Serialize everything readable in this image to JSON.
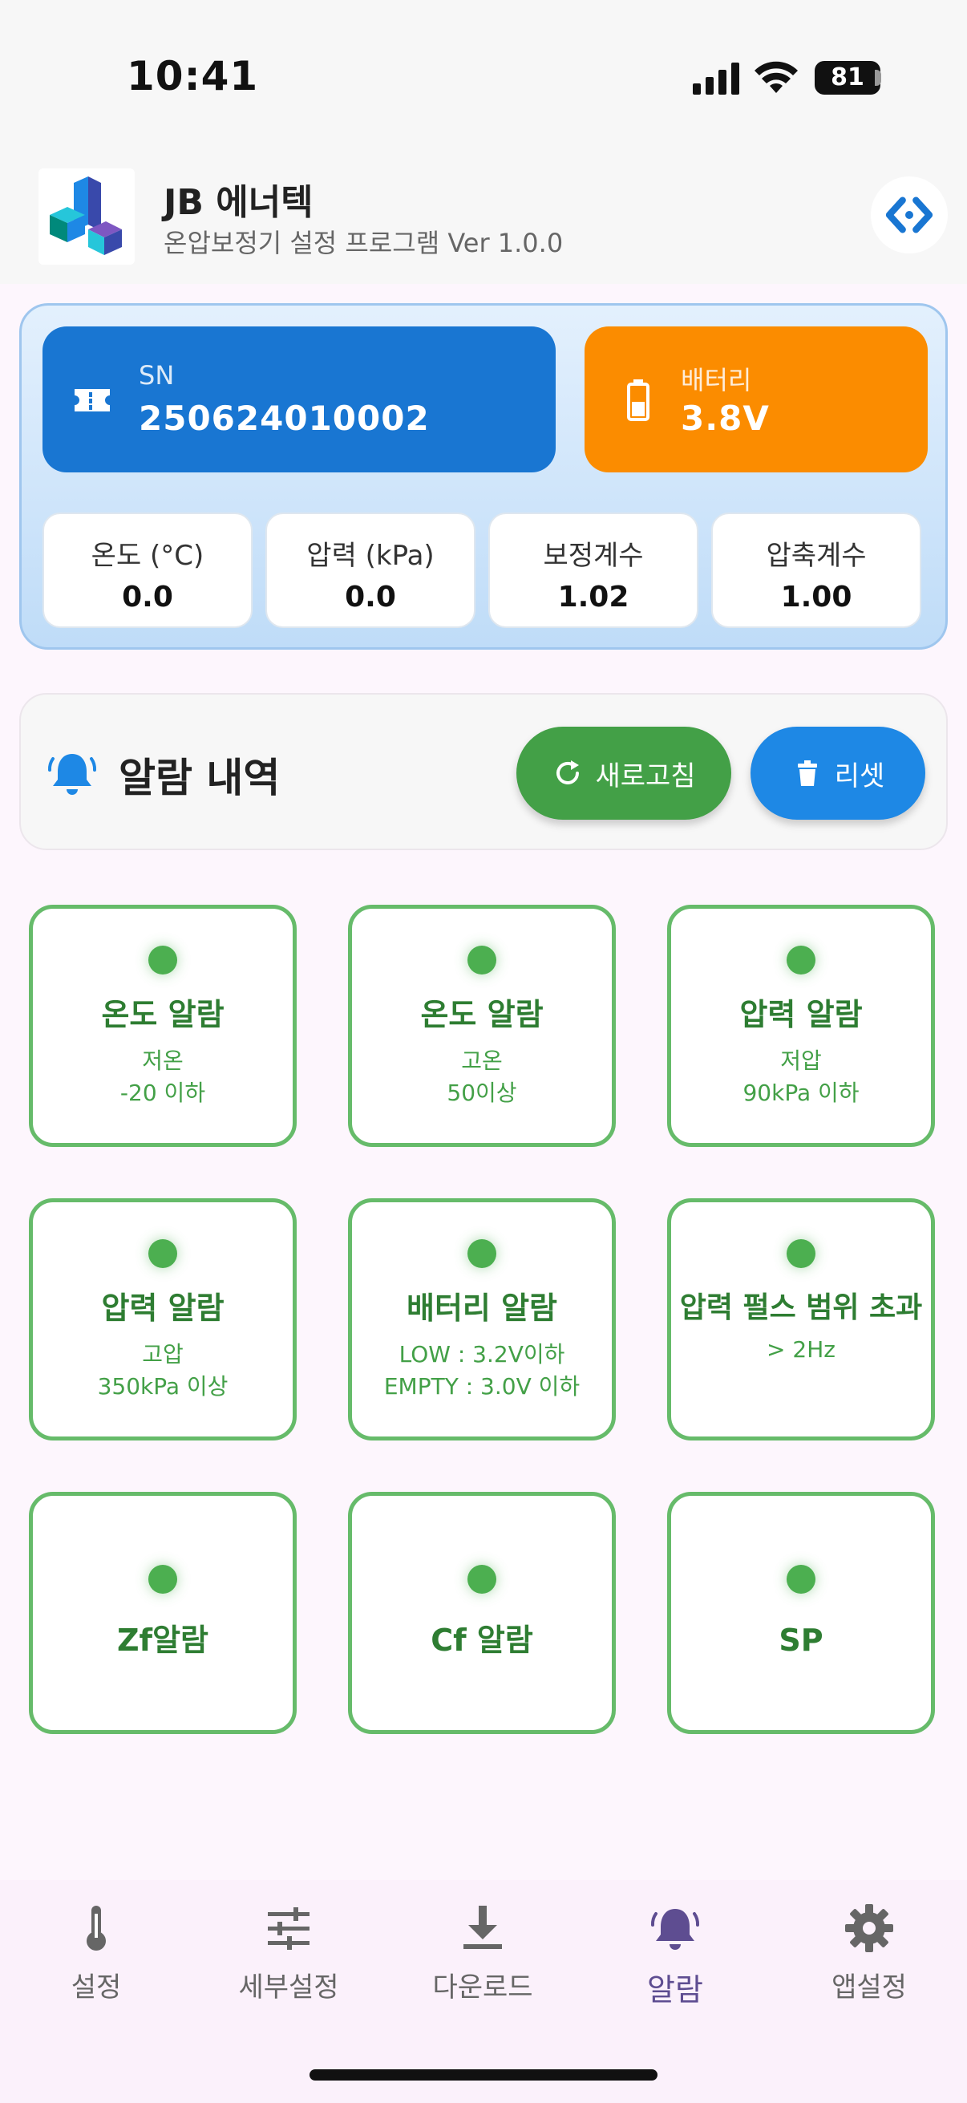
{
  "status_bar": {
    "time": "10:41",
    "battery": "81"
  },
  "header": {
    "title": "JB 에너텍",
    "subtitle": "온압보정기 설정 프로그램 Ver 1.0.0"
  },
  "device": {
    "sn_label": "SN",
    "sn_value": "250624010002",
    "battery_label": "배터리",
    "battery_value": "3.8V",
    "metrics": [
      {
        "label": "온도 (°C)",
        "value": "0.0"
      },
      {
        "label": "압력 (kPa)",
        "value": "0.0"
      },
      {
        "label": "보정계수",
        "value": "1.02"
      },
      {
        "label": "압축계수",
        "value": "1.00"
      }
    ]
  },
  "alarm_section": {
    "title": "알람 내역",
    "refresh_label": "새로고침",
    "reset_label": "리셋"
  },
  "alarms": [
    {
      "name": "온도 알람",
      "desc1": "저온",
      "desc2": "-20 이하"
    },
    {
      "name": "온도 알람",
      "desc1": "고온",
      "desc2": "50이상"
    },
    {
      "name": "압력 알람",
      "desc1": "저압",
      "desc2": "90kPa 이하"
    },
    {
      "name": "압력 알람",
      "desc1": "고압",
      "desc2": "350kPa 이상"
    },
    {
      "name": "배터리 알람",
      "desc1": "LOW : 3.2V이하",
      "desc2": "EMPTY : 3.0V 이하"
    },
    {
      "name": "압력 펄스 범위 초과",
      "desc1": "> 2Hz",
      "desc2": ""
    },
    {
      "name": "Zf알람",
      "desc1": "",
      "desc2": ""
    },
    {
      "name": "Cf 알람",
      "desc1": "",
      "desc2": ""
    },
    {
      "name": "SP",
      "desc1": "",
      "desc2": ""
    }
  ],
  "nav": [
    {
      "label": "설정",
      "icon": "thermometer-icon"
    },
    {
      "label": "세부설정",
      "icon": "sliders-icon"
    },
    {
      "label": "다운로드",
      "icon": "download-icon"
    },
    {
      "label": "알람",
      "icon": "bell-icon"
    },
    {
      "label": "앱설정",
      "icon": "gear-icon"
    }
  ],
  "colors": {
    "primary_blue": "#1976d2",
    "battery_orange": "#fb8c00",
    "alarm_green": "#4caf50",
    "nav_active": "#5e4d91"
  }
}
